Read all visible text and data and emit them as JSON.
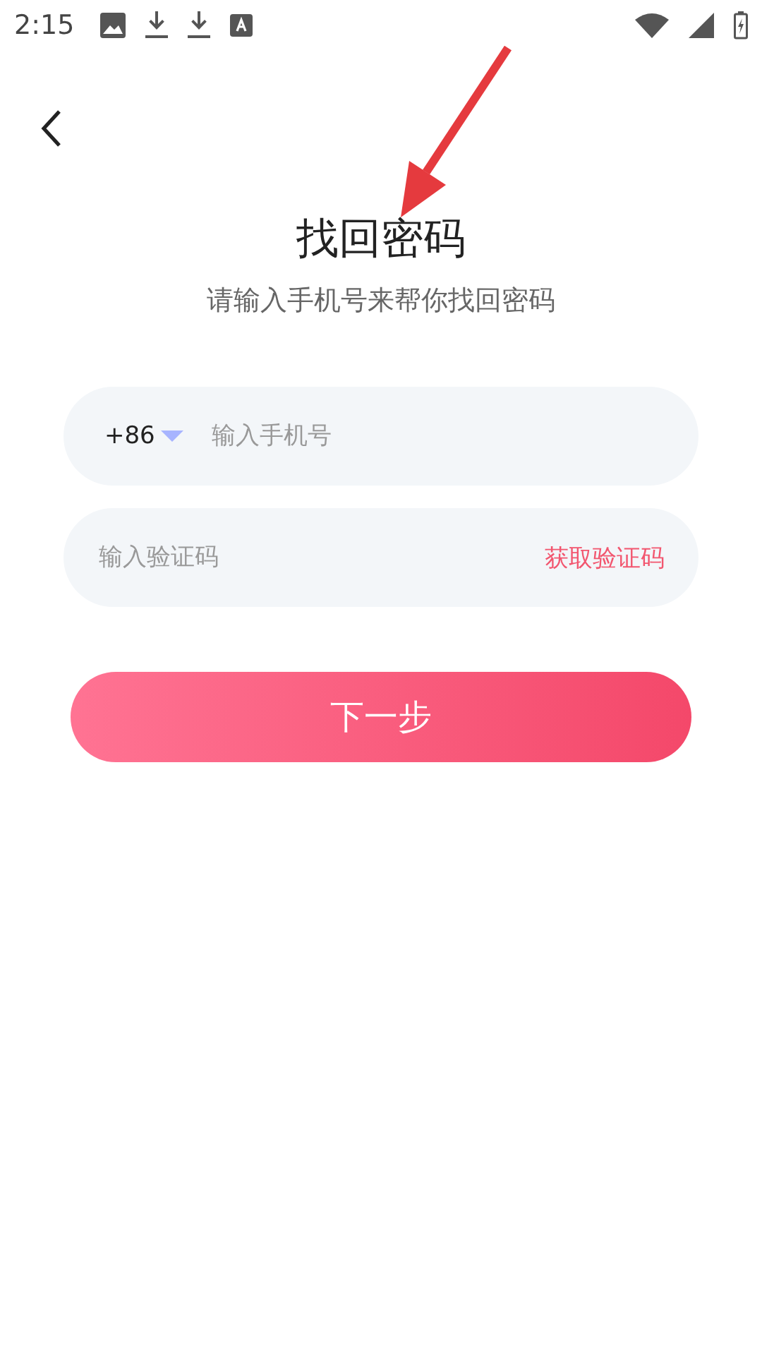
{
  "status_bar": {
    "time": "2:15"
  },
  "title": "找回密码",
  "subtitle": "请输入手机号来帮你找回密码",
  "phone_field": {
    "country_code": "+86",
    "placeholder": "输入手机号"
  },
  "code_field": {
    "placeholder": "输入验证码",
    "action": "获取验证码"
  },
  "next_button": "下一步"
}
